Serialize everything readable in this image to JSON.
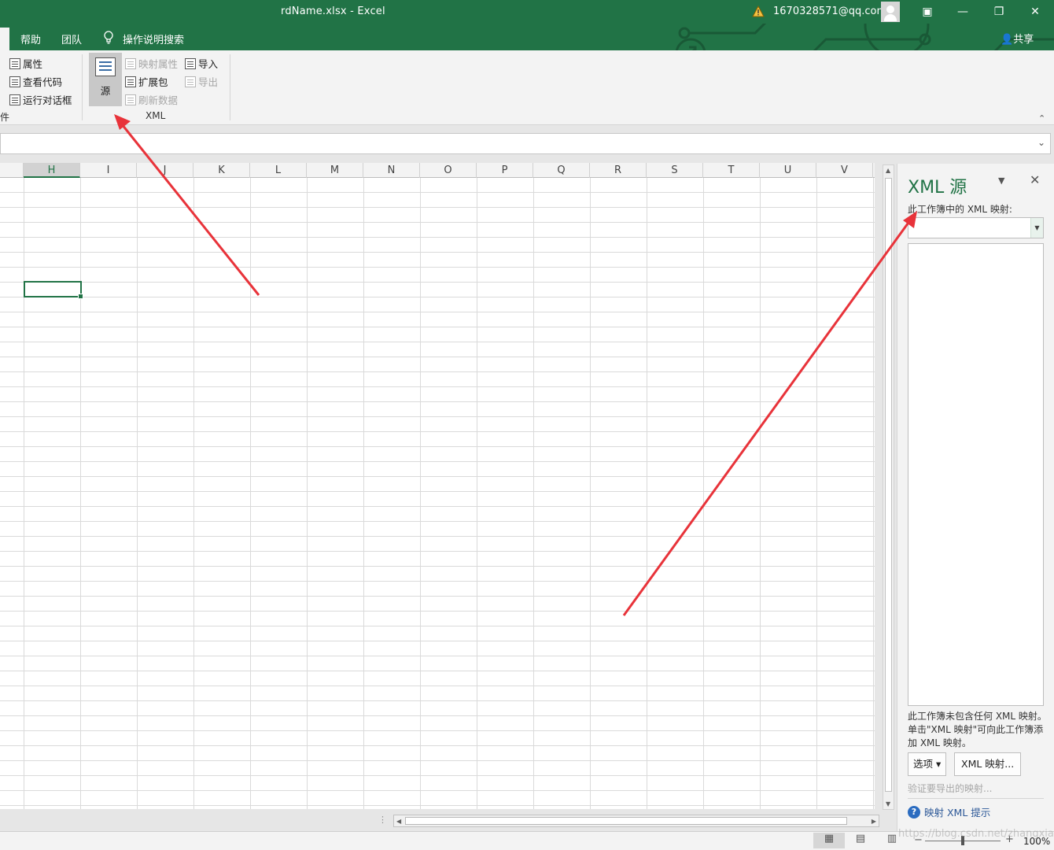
{
  "window": {
    "title": "rdName.xlsx  -  Excel",
    "account": "1670328571@qq.com",
    "share_label": "共享"
  },
  "tabs": {
    "help": "帮助",
    "team": "团队",
    "search": "操作说明搜索"
  },
  "ribbon": {
    "controls_group": {
      "properties": "属性",
      "view_code": "查看代码",
      "run_dialog": "运行对话框",
      "group_label": "控件"
    },
    "xml_group": {
      "source": "源",
      "map_properties": "映射属性",
      "expansion_packs": "扩展包",
      "refresh_data": "刷新数据",
      "import": "导入",
      "export": "导出",
      "group_label": "XML"
    }
  },
  "grid": {
    "columns": [
      "H",
      "I",
      "J",
      "K",
      "L",
      "M",
      "N",
      "O",
      "P",
      "Q",
      "R",
      "S",
      "T",
      "U",
      "V"
    ],
    "selected_column": "H"
  },
  "xml_pane": {
    "title": "XML 源",
    "maps_label": "此工作簿中的 XML 映射:",
    "selected_map": "",
    "empty_message": "此工作簿未包含任何 XML 映射。单击\"XML 映射\"可向此工作簿添加 XML 映射。",
    "options_button": "选项 ▾",
    "maps_button": "XML 映射...",
    "verify_link": "验证要导出的映射...",
    "tips_link": "映射 XML 提示"
  },
  "status": {
    "zoom": "100%"
  },
  "watermark": "https://blog.csdn.net/zhangxiao",
  "colors": {
    "brand": "#217346",
    "arrow": "#e8333a"
  }
}
